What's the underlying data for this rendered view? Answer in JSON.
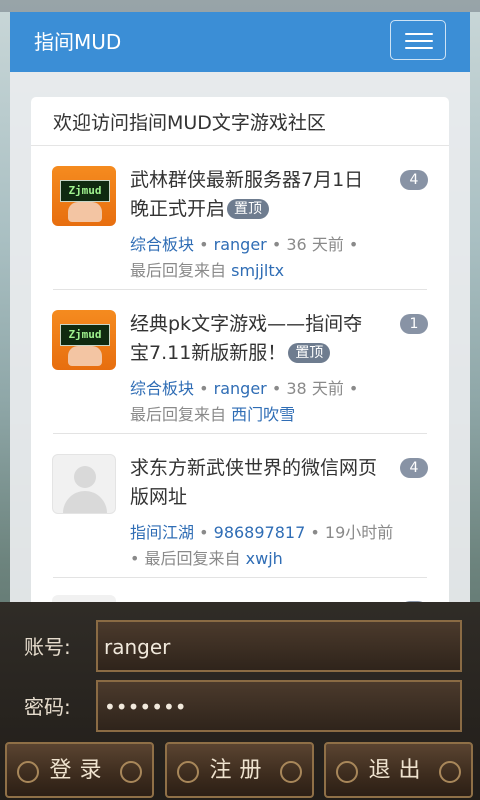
{
  "navbar": {
    "brand": "指间MUD",
    "menu_icon": "hamburger-menu-icon"
  },
  "card": {
    "title": "欢迎访问指间MUD文字游戏社区"
  },
  "topics": [
    {
      "avatar": "zjmud-logo",
      "avatar_text": "Zjmud",
      "title": "武林群侠最新服务器7月1日晚正式开启",
      "badge": "置顶",
      "board": "综合板块",
      "author": "ranger",
      "time": "36 天前",
      "last_reply_prefix": "最后回复来自",
      "last_reply_user": "smjjltx",
      "reply_count": "4",
      "dot": "•"
    },
    {
      "avatar": "zjmud-logo",
      "avatar_text": "Zjmud",
      "title": "经典pk文字游戏——指间夺宝7.11新版新服！",
      "badge": "置顶",
      "board": "综合板块",
      "author": "ranger",
      "time": "38 天前",
      "last_reply_prefix": "最后回复来自",
      "last_reply_user": "西门吹雪",
      "reply_count": "1",
      "dot": "•"
    },
    {
      "avatar": "default-user",
      "title": "求东方新武侠世界的微信网页版网址",
      "board": "指间江湖",
      "author": "986897817",
      "time": "19小时前",
      "last_reply_prefix": "最后回复来自",
      "last_reply_user": "xwjh",
      "reply_count": "4",
      "dot": "•"
    }
  ],
  "login": {
    "account_label": "账号:",
    "account_value": "ranger",
    "password_label": "密码:",
    "password_value": "•••••••",
    "login_button": "登录",
    "register_button": "注册",
    "exit_button": "退出"
  }
}
